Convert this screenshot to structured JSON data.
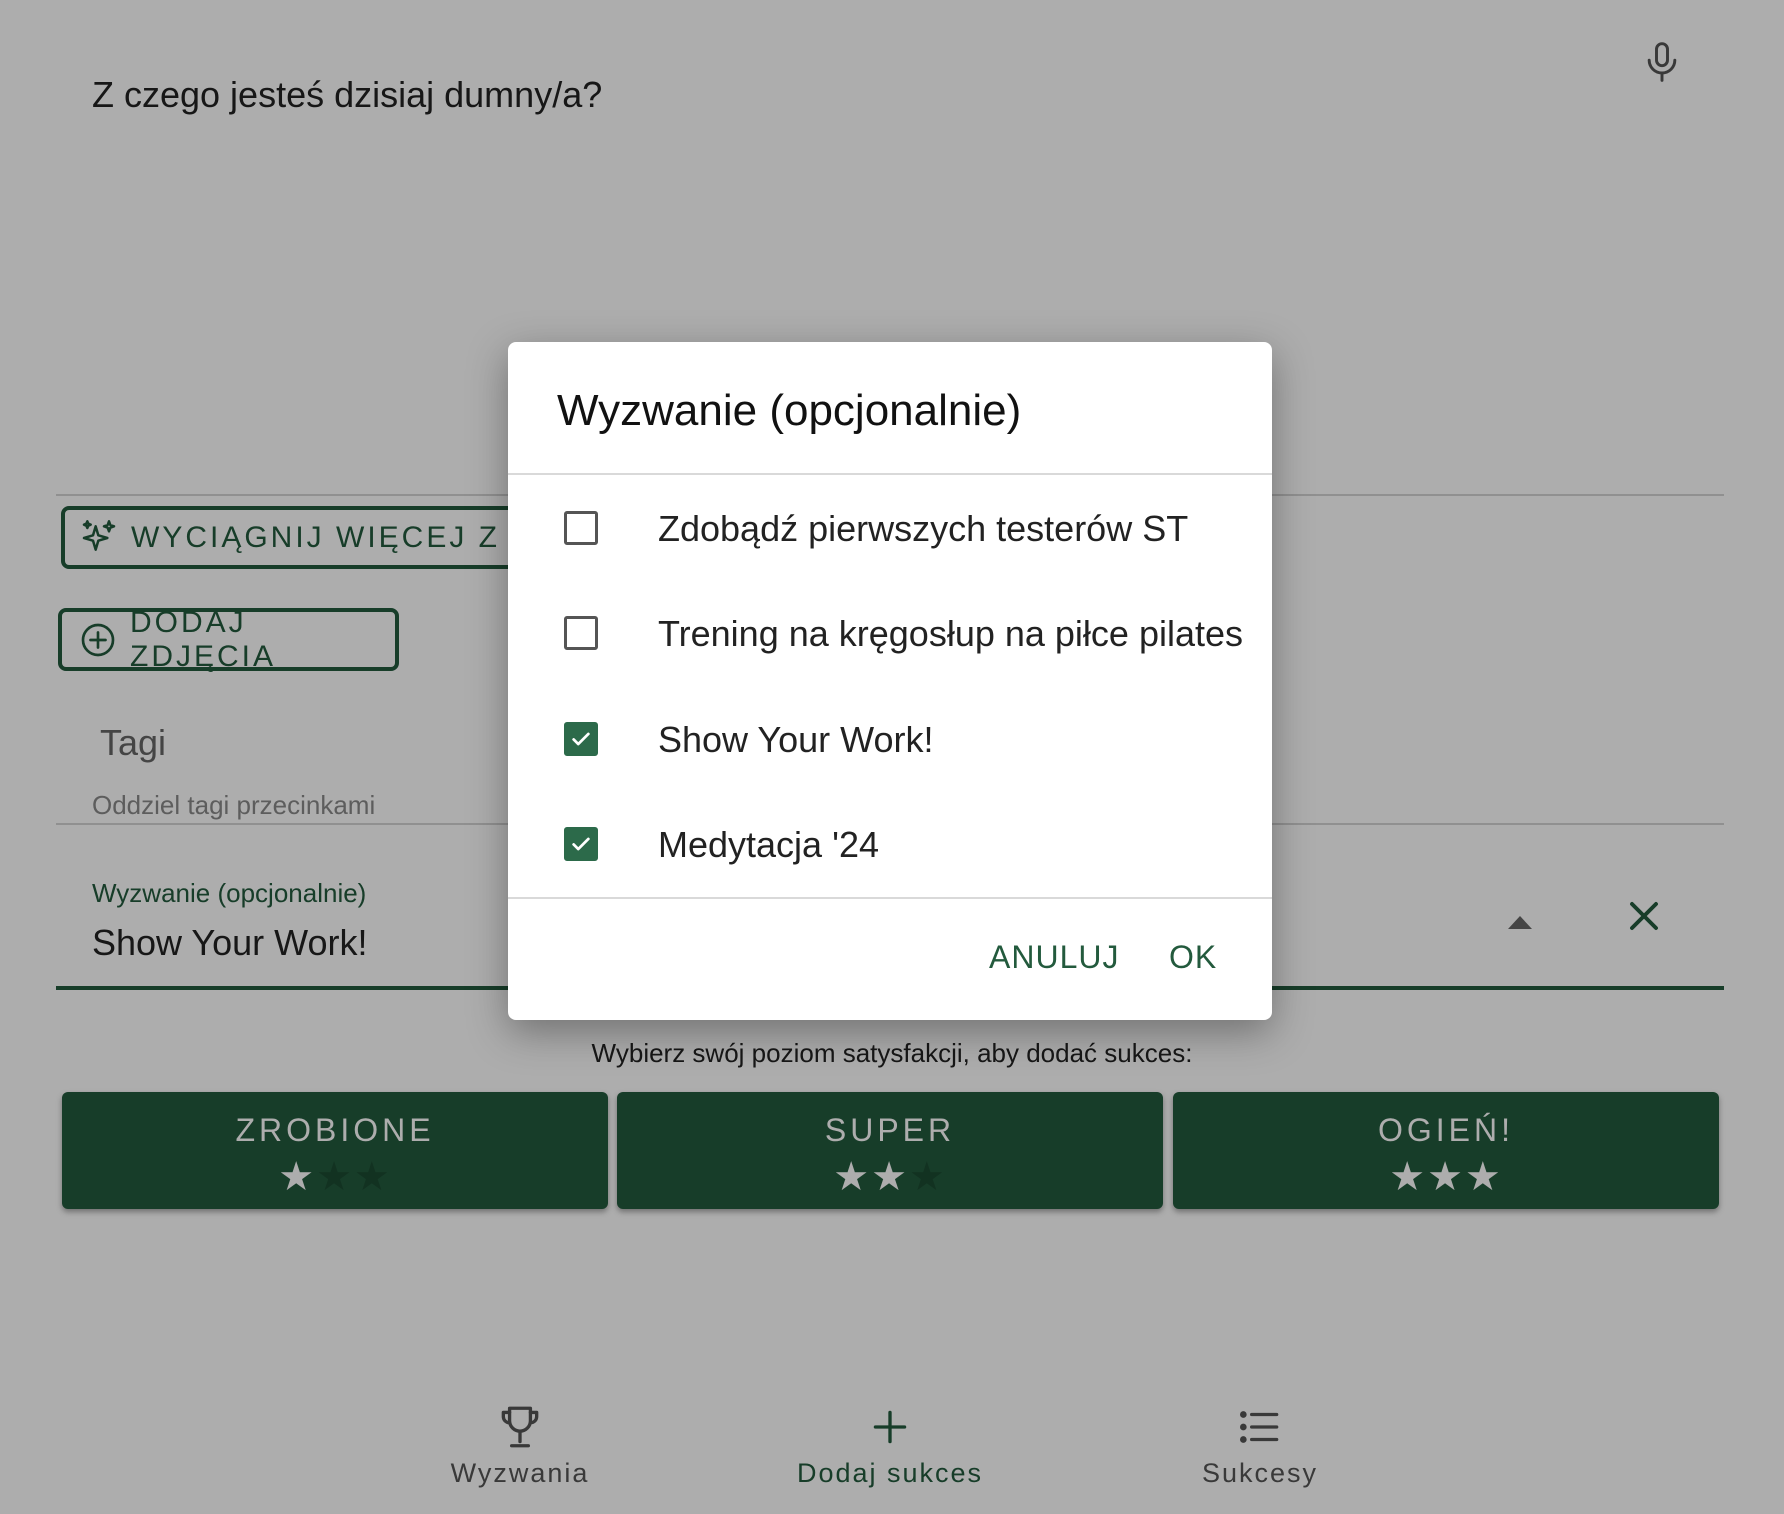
{
  "form": {
    "prompt": "Z czego jesteś dzisiaj dumny/a?",
    "ai_button": "WYCIĄGNIJ WIĘCEJ Z AI",
    "photo_button": "DODAJ ZDJĘCIA",
    "tags_label": "Tagi",
    "tags_helper": "Oddziel tagi przecinkami",
    "challenge_label": "Wyzwanie (opcjonalnie)",
    "challenge_value": "Show Your Work!",
    "satisfaction_prompt": "Wybierz swój poziom satysfakcji, aby dodać sukces:"
  },
  "satisfaction": [
    {
      "label": "ZROBIONE",
      "stars": 1,
      "max": 3
    },
    {
      "label": "SUPER",
      "stars": 2,
      "max": 3
    },
    {
      "label": "OGIEŃ!",
      "stars": 3,
      "max": 3
    }
  ],
  "nav": [
    {
      "label": "Wyzwania",
      "icon": "trophy-icon",
      "active": false
    },
    {
      "label": "Dodaj sukces",
      "icon": "plus-icon",
      "active": true
    },
    {
      "label": "Sukcesy",
      "icon": "list-icon",
      "active": false
    }
  ],
  "dialog": {
    "title": "Wyzwanie (opcjonalnie)",
    "options": [
      {
        "label": "Zdobądź pierwszych testerów ST",
        "checked": false
      },
      {
        "label": "Trening na kręgosłup na piłce pilates",
        "checked": false
      },
      {
        "label": "Show Your Work!",
        "checked": true
      },
      {
        "label": "Medytacja '24",
        "checked": true
      }
    ],
    "cancel": "ANULUJ",
    "ok": "OK"
  },
  "colors": {
    "accent": "#235a3d",
    "checkbox_checked": "#2c6a4a",
    "scrim": "rgba(0,0,0,0.32)"
  }
}
